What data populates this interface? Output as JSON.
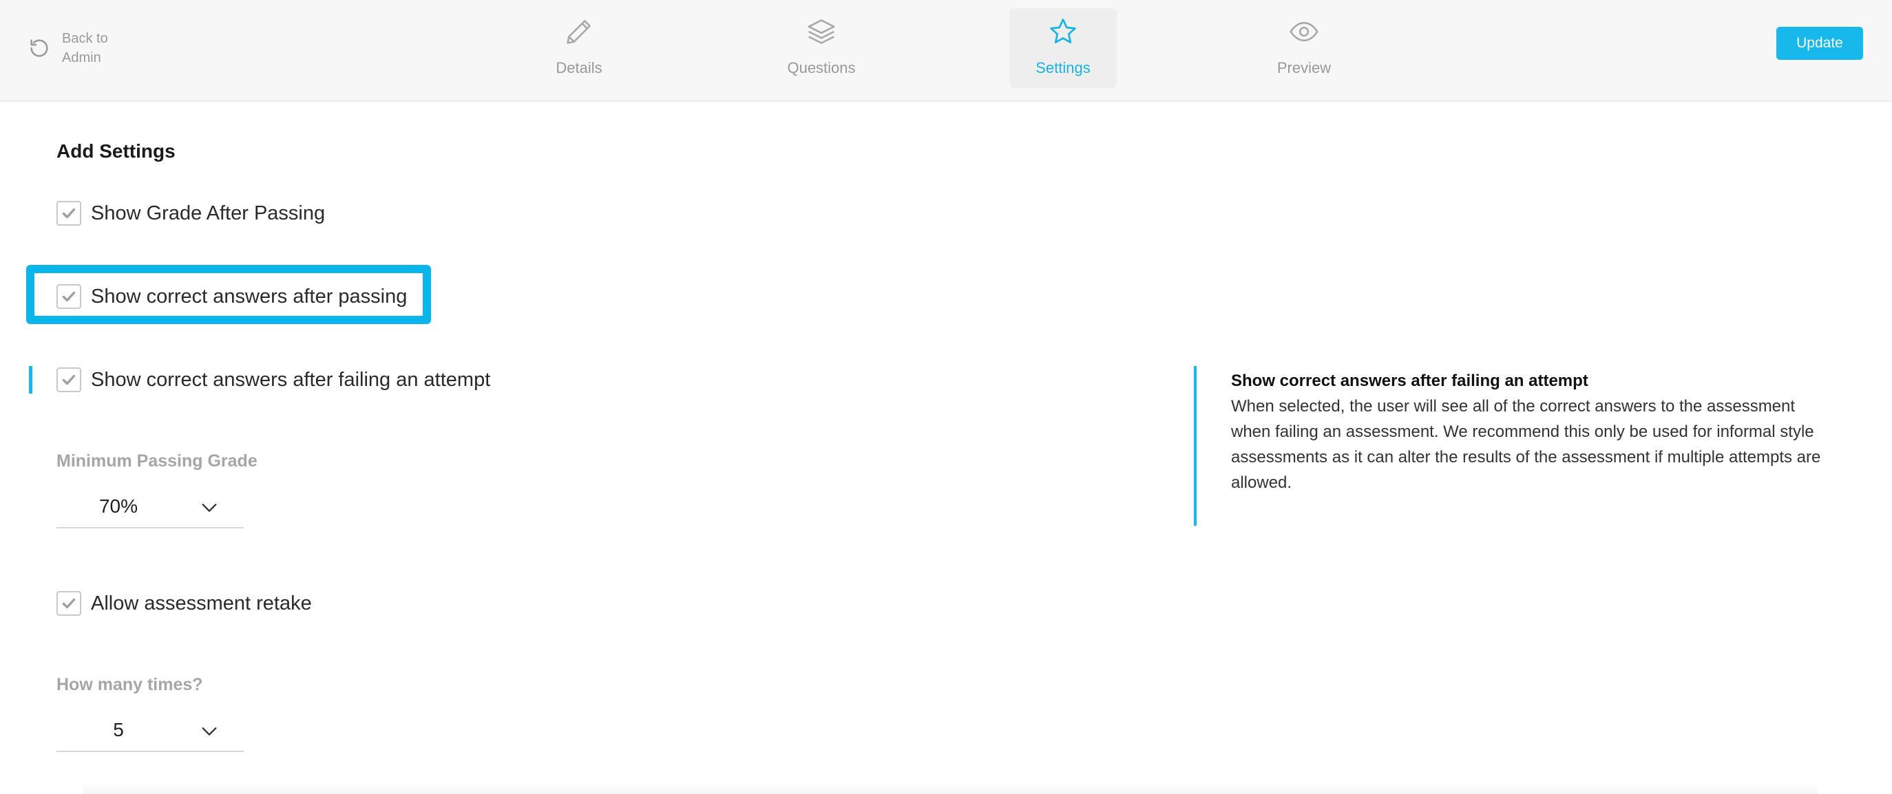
{
  "header": {
    "back_label": "Back to Admin",
    "back_icon": "refresh-icon",
    "tabs": [
      {
        "label": "Details",
        "icon": "pencil-icon",
        "active": false
      },
      {
        "label": "Questions",
        "icon": "layers-icon",
        "active": false
      },
      {
        "label": "Settings",
        "icon": "star-icon",
        "active": true
      },
      {
        "label": "Preview",
        "icon": "eye-icon",
        "active": false
      }
    ],
    "update_label": "Update"
  },
  "settings": {
    "title": "Add Settings",
    "options": [
      {
        "label": "Show Grade After Passing",
        "checked": true
      },
      {
        "label": "Show correct answers after passing",
        "checked": true
      },
      {
        "label": "Show correct answers after failing an attempt",
        "checked": true
      },
      {
        "label": "Allow assessment retake",
        "checked": true
      }
    ],
    "min_grade": {
      "label": "Minimum Passing Grade",
      "value": "70%"
    },
    "retake_times": {
      "label": "How many times?",
      "value": "5"
    }
  },
  "help": {
    "title": "Show correct answers after failing an attempt",
    "body": "When selected, the user will see all of the correct answers to the assessment when failing an assessment. We recommend this only be used for informal style assessments as it can alter the results of the assessment if multiple attempts are allowed."
  },
  "colors": {
    "accent": "#17b8ec",
    "highlight": "#0ab5ec",
    "muted_text": "#999999"
  }
}
